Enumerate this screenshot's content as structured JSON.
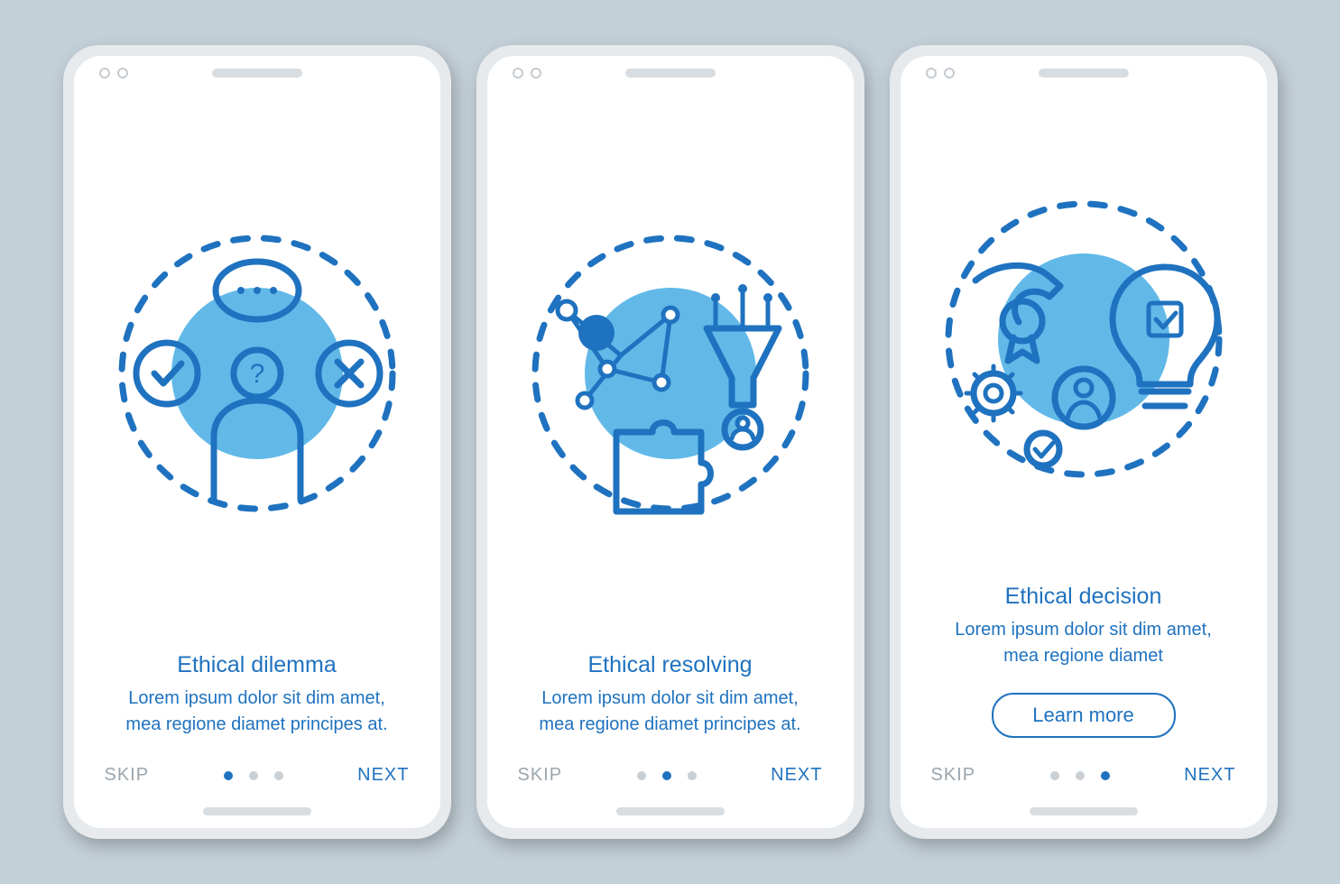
{
  "colors": {
    "accent": "#1f72bf",
    "muted": "#9aa5ad",
    "bg": "#c4d0d8"
  },
  "screens": [
    {
      "illustration": "dilemma-icon",
      "title": "Ethical dilemma",
      "body": "Lorem ipsum dolor sit dim amet, mea regione diamet principes at.",
      "skip": "SKIP",
      "next": "NEXT",
      "learn_more": null,
      "pager": {
        "count": 3,
        "active": 0
      }
    },
    {
      "illustration": "resolving-icon",
      "title": "Ethical resolving",
      "body": "Lorem ipsum dolor sit dim amet, mea regione diamet principes at.",
      "skip": "SKIP",
      "next": "NEXT",
      "learn_more": null,
      "pager": {
        "count": 3,
        "active": 1
      }
    },
    {
      "illustration": "decision-icon",
      "title": "Ethical decision",
      "body": "Lorem ipsum dolor sit dim amet, mea regione diamet",
      "skip": "SKIP",
      "next": "NEXT",
      "learn_more": "Learn more",
      "pager": {
        "count": 3,
        "active": 2
      }
    }
  ]
}
